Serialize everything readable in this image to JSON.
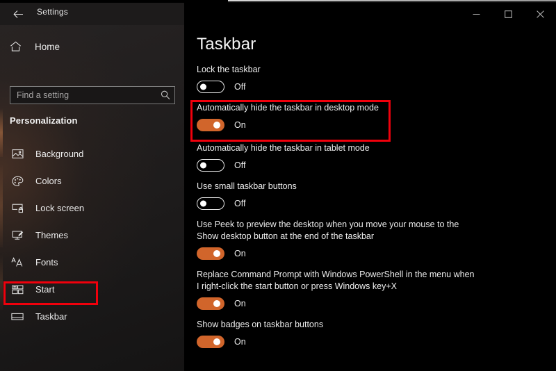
{
  "window": {
    "title": "Settings",
    "back_icon": "back-arrow-icon",
    "controls": {
      "minimize": "minimize-icon",
      "maximize": "maximize-icon",
      "close": "close-icon"
    }
  },
  "sidebar": {
    "home": {
      "label": "Home",
      "icon": "home-icon"
    },
    "search": {
      "value": "",
      "placeholder": "Find a setting",
      "icon": "search-icon"
    },
    "section_header": "Personalization",
    "items": [
      {
        "label": "Background",
        "icon": "image-icon",
        "selected": false
      },
      {
        "label": "Colors",
        "icon": "palette-icon",
        "selected": false
      },
      {
        "label": "Lock screen",
        "icon": "lock-screen-icon",
        "selected": false
      },
      {
        "label": "Themes",
        "icon": "themes-brush-icon",
        "selected": false
      },
      {
        "label": "Fonts",
        "icon": "fonts-aa-icon",
        "selected": false
      },
      {
        "label": "Start",
        "icon": "start-grid-icon",
        "selected": false
      },
      {
        "label": "Taskbar",
        "icon": "taskbar-icon",
        "selected": true
      }
    ]
  },
  "main": {
    "page_title": "Taskbar",
    "settings": [
      {
        "label": "Lock the taskbar",
        "state": "Off",
        "on": false
      },
      {
        "label": "Automatically hide the taskbar in desktop mode",
        "state": "On",
        "on": true
      },
      {
        "label": "Automatically hide the taskbar in tablet mode",
        "state": "Off",
        "on": false
      },
      {
        "label": "Use small taskbar buttons",
        "state": "Off",
        "on": false
      },
      {
        "label": "Use Peek to preview the desktop when you move your mouse to the Show desktop button at the end of the taskbar",
        "state": "On",
        "on": true
      },
      {
        "label": "Replace Command Prompt with Windows PowerShell in the menu when I right-click the start button or press Windows key+X",
        "state": "On",
        "on": true
      },
      {
        "label": "Show badges on taskbar buttons",
        "state": "On",
        "on": true
      }
    ]
  },
  "annotations": {
    "highlight_color": "#f0000c",
    "boxes": [
      {
        "target": "sidebar-item-taskbar"
      },
      {
        "target": "setting-automatically-hide-desktop-mode"
      }
    ]
  },
  "colors": {
    "accent_on": "#d1652b",
    "main_background": "#000000",
    "sidebar_background": "#1d1b1b",
    "text": "#ededed"
  }
}
